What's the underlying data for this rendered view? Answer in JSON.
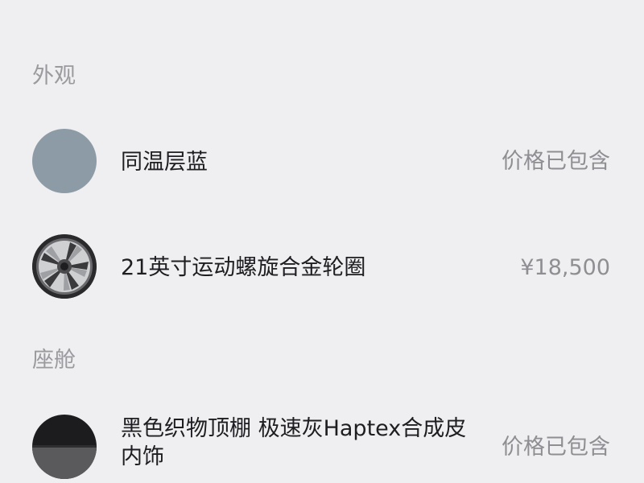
{
  "sections": [
    {
      "title": "外观",
      "items": [
        {
          "name": "同温层蓝",
          "price": "价格已包含",
          "swatch_color": "#8d9ba6",
          "icon": "color-swatch-icon"
        },
        {
          "name": "21英寸运动螺旋合金轮圈",
          "price": "¥18,500",
          "icon": "wheel-icon"
        }
      ]
    },
    {
      "title": "座舱",
      "items": [
        {
          "name_line1": "黑色织物顶棚 极速灰Haptex合成皮",
          "name_line2": "内饰",
          "price": "价格已包含",
          "swatch_top_color": "#1c1c1e",
          "swatch_bottom_color": "#5a5a5c",
          "icon": "interior-swatch-icon"
        }
      ]
    }
  ]
}
